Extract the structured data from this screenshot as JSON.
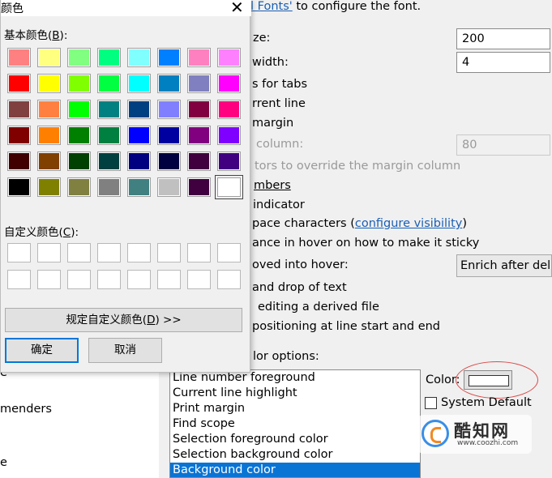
{
  "background": {
    "top_fragment_link": "l Fonts'",
    "top_fragment_text": " to configure the font.",
    "lines": [
      {
        "text": "ze:"
      },
      {
        "text": "width:"
      },
      {
        "text": "s for tabs"
      },
      {
        "text": "rrent line"
      },
      {
        "text": "margin"
      },
      {
        "text": "column:"
      },
      {
        "text": "tors to override the margin column"
      },
      {
        "text": "mbers"
      },
      {
        "text": "indicator"
      },
      {
        "text": "pace characters ("
      },
      {
        "text": "ance in hover on how to make it sticky"
      },
      {
        "text": "oved into hover:"
      },
      {
        "text": "and drop of text"
      },
      {
        "text": "editing a derived file"
      },
      {
        "text": "positioning at line start and end"
      },
      {
        "text": "lor options:"
      }
    ],
    "configure_visibility_link": "configure visibility",
    "close_paren": ")",
    "font_size_value": "200",
    "tab_width_value": "4",
    "margin_column_value": "80",
    "hover_combo_value": "Enrich after delay",
    "left_tree_items": [
      "e",
      "menders",
      "e"
    ],
    "color_list": [
      "Line number foreground",
      "Current line highlight",
      "Print margin",
      "Find scope",
      "Selection foreground color",
      "Selection background color",
      "Background color"
    ],
    "color_label": "Color:",
    "color_swatch_value": "#ffffff",
    "system_default_label": "System Default",
    "watermark_text": "酷知网",
    "watermark_url": "www.coozhi.com"
  },
  "dialog": {
    "title": "颜色",
    "basic_colors_label": "基本颜色(",
    "basic_colors_key": "B",
    "basic_colors_tail": "):",
    "custom_colors_label": "自定义颜色(",
    "custom_colors_key": "C",
    "custom_colors_tail": "):",
    "define_custom_button": "规定自定义颜色(",
    "define_custom_key": "D",
    "define_custom_tail": ") >>",
    "ok_button": "确定",
    "cancel_button": "取消",
    "basic_colors": [
      [
        "#ff8080",
        "#ffff80",
        "#80ff80",
        "#00ff80",
        "#80ffff",
        "#0080ff",
        "#ff80c0",
        "#ff80ff"
      ],
      [
        "#ff0000",
        "#ffff00",
        "#80ff00",
        "#00ff40",
        "#00ffff",
        "#0080c0",
        "#8080c0",
        "#ff00ff"
      ],
      [
        "#804040",
        "#ff8040",
        "#00ff00",
        "#008080",
        "#004080",
        "#8080ff",
        "#800040",
        "#ff0080"
      ],
      [
        "#800000",
        "#ff8000",
        "#008000",
        "#008040",
        "#0000ff",
        "#0000a0",
        "#800080",
        "#8000ff"
      ],
      [
        "#400000",
        "#804000",
        "#004000",
        "#004040",
        "#000080",
        "#000040",
        "#400040",
        "#400080"
      ],
      [
        "#000000",
        "#808000",
        "#808040",
        "#808080",
        "#408080",
        "#c0c0c0",
        "#400040",
        "#ffffff"
      ]
    ],
    "selected_swatch": "row 6 col 8"
  }
}
